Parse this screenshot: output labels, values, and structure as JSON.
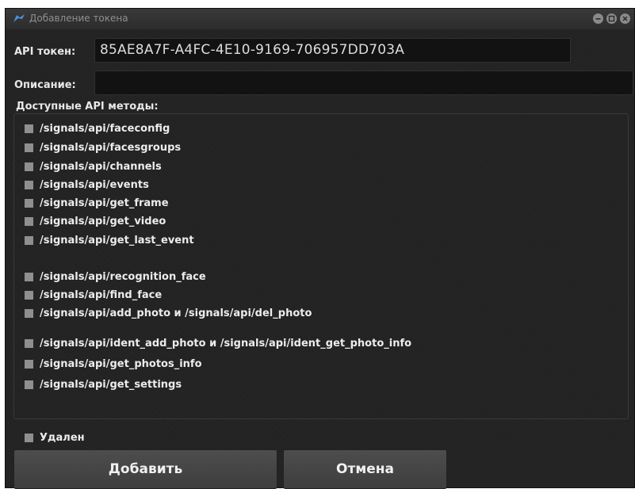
{
  "window": {
    "title": "Добавление токена",
    "controls": [
      "minimize",
      "maximize",
      "close"
    ]
  },
  "token": {
    "label": "API токен:",
    "value": "85AE8A7F-A4FC-4E10-9169-706957DD703A"
  },
  "description": {
    "label": "Описание:",
    "value": ""
  },
  "methods": {
    "label": "Доступные API методы:",
    "items": [
      {
        "label": "/signals/api/faceconfig",
        "checked": false
      },
      {
        "label": "/signals/api/facesgroups",
        "checked": false
      },
      {
        "label": "/signals/api/channels",
        "checked": false
      },
      {
        "label": "/signals/api/events",
        "checked": false
      },
      {
        "label": "/signals/api/get_frame",
        "checked": false
      },
      {
        "label": "/signals/api/get_video",
        "checked": false
      },
      {
        "label": "/signals/api/get_last_event",
        "checked": false
      },
      {
        "label": "/signals/api/recognition_face",
        "checked": false
      },
      {
        "label": "/signals/api/find_face",
        "checked": false
      },
      {
        "label": "/signals/api/add_photo и /signals/api/del_photo",
        "checked": false
      },
      {
        "label": "/signals/api/ident_add_photo и /signals/api/ident_get_photo_info",
        "checked": false
      },
      {
        "label": "/signals/api/get_photos_info",
        "checked": false
      },
      {
        "label": "/signals/api/get_settings",
        "checked": false
      }
    ]
  },
  "deleted": {
    "label": "Удален",
    "checked": false
  },
  "buttons": {
    "add": "Добавить",
    "cancel": "Отмена"
  },
  "colors": {
    "background": "#222222",
    "field": "#121212",
    "checkbox": "#8f8f8f",
    "text": "#e8e8e8"
  }
}
